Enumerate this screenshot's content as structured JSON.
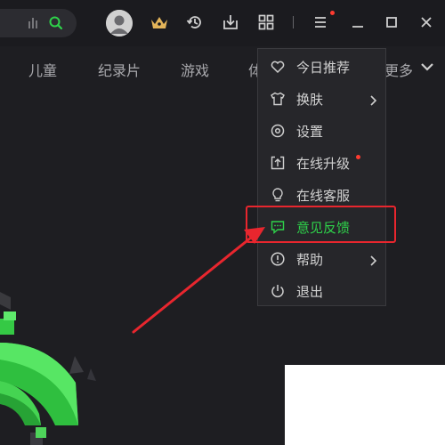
{
  "nav": {
    "tabs": [
      "儿童",
      "纪录片",
      "游戏",
      "体",
      "更多"
    ]
  },
  "menu": {
    "items": [
      {
        "label": "今日推荐",
        "icon": "heart-icon"
      },
      {
        "label": "换肤",
        "icon": "shirt-icon",
        "submenu": true
      },
      {
        "label": "设置",
        "icon": "settings-icon"
      },
      {
        "label": "在线升级",
        "icon": "upgrade-icon",
        "badge": true
      },
      {
        "label": "在线客服",
        "icon": "bulb-icon"
      },
      {
        "label": "意见反馈",
        "icon": "feedback-icon",
        "active": true
      },
      {
        "label": "帮助",
        "icon": "help-icon",
        "submenu": true
      },
      {
        "label": "退出",
        "icon": "power-icon"
      }
    ]
  },
  "colors": {
    "accent_green": "#2ed34a",
    "annotation_red": "#e8262e",
    "vip_gold": "#e3b459",
    "background": "#1e1e22"
  }
}
